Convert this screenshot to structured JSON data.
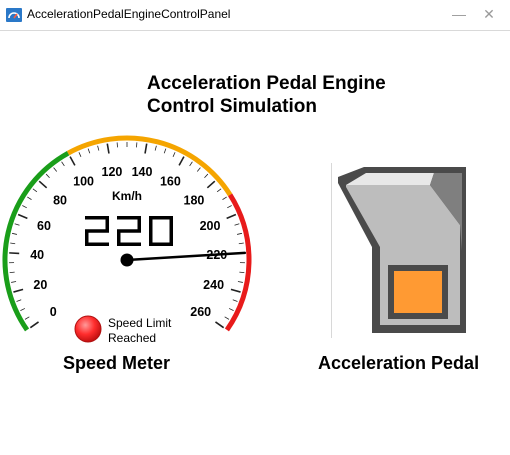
{
  "window": {
    "title": "AccelerationPedalEngineControlPanel",
    "minimize_glyph": "—",
    "close_glyph": "✕"
  },
  "heading": {
    "line1": "Acceleration Pedal Engine",
    "line2": "Control Simulation"
  },
  "speedometer": {
    "caption": "Speed Meter",
    "unit": "Km/h",
    "digital_readout": "220",
    "ticks": [
      "0",
      "20",
      "40",
      "60",
      "80",
      "100",
      "120",
      "140",
      "160",
      "180",
      "200",
      "220",
      "240",
      "260"
    ],
    "min": 0,
    "max": 260,
    "needle_value": 220,
    "limit_indicator": {
      "label_line1": "Speed Limit",
      "label_line2": "Reached",
      "color": "#ff2d2d"
    },
    "zones": [
      {
        "from": 0,
        "to": 100,
        "color": "#1a9e1a"
      },
      {
        "from": 100,
        "to": 190,
        "color": "#f5a500"
      },
      {
        "from": 190,
        "to": 260,
        "color": "#e81b1b"
      }
    ]
  },
  "pedal": {
    "caption": "Acceleration Pedal",
    "frame_color": "#4a4a4a",
    "body_color": "#bdbdbd",
    "button_color": "#ff9a33"
  }
}
